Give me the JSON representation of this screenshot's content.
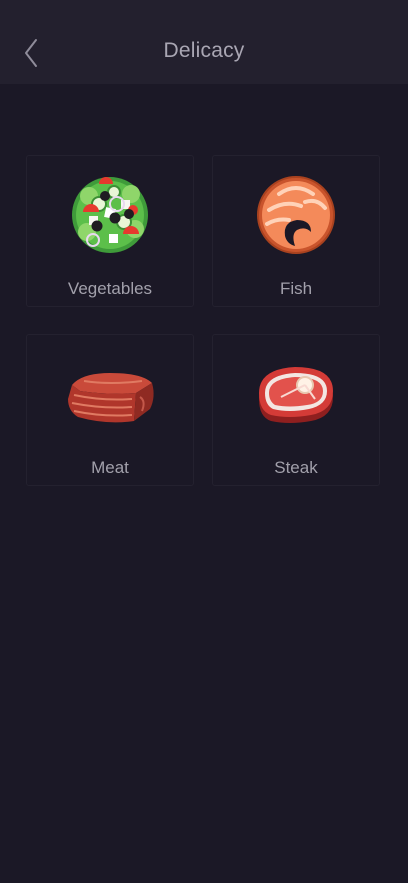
{
  "header": {
    "title": "Delicacy",
    "back_icon": "chevron-left-icon"
  },
  "categories": [
    {
      "label": "Vegetables",
      "icon": "salad-icon"
    },
    {
      "label": "Fish",
      "icon": "salmon-icon"
    },
    {
      "label": "Meat",
      "icon": "meat-icon"
    },
    {
      "label": "Steak",
      "icon": "steak-icon"
    }
  ],
  "colors": {
    "background": "#1b1826",
    "header": "#23202e",
    "title_text": "#a9a6b3",
    "label_text": "#a2a0ab"
  }
}
